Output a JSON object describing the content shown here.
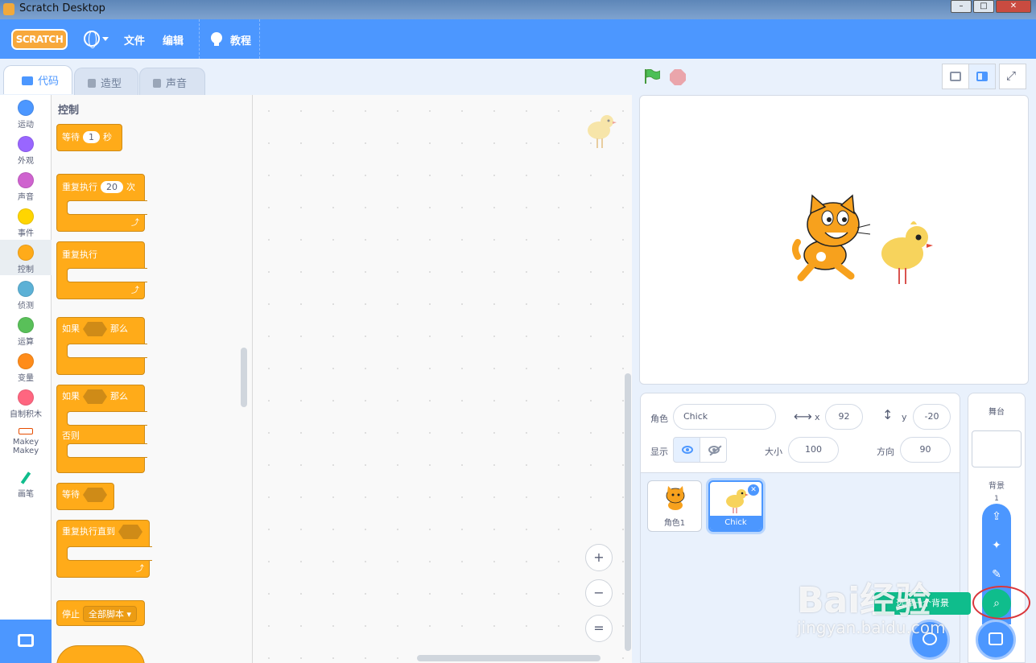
{
  "window": {
    "title": "Scratch Desktop"
  },
  "menubar": {
    "logo": "SCRATCH",
    "file": "文件",
    "edit": "编辑",
    "tutorials": "教程"
  },
  "tabs": [
    {
      "label": "代码",
      "active": true
    },
    {
      "label": "造型",
      "active": false
    },
    {
      "label": "声音",
      "active": false
    }
  ],
  "categories": [
    {
      "label": "运动",
      "color": "#4c97ff"
    },
    {
      "label": "外观",
      "color": "#9966ff"
    },
    {
      "label": "声音",
      "color": "#cf63cf"
    },
    {
      "label": "事件",
      "color": "#ffd500"
    },
    {
      "label": "控制",
      "color": "#ffab19",
      "selected": true
    },
    {
      "label": "侦测",
      "color": "#5cb1d6"
    },
    {
      "label": "运算",
      "color": "#59c059"
    },
    {
      "label": "变量",
      "color": "#ff8c1a"
    },
    {
      "label": "自制积木",
      "color": "#ff6680"
    },
    {
      "label": "Makey Makey",
      "color": "#e64d00"
    },
    {
      "label": "画笔",
      "color": "#0fbd8c"
    }
  ],
  "palette": {
    "title": "控制",
    "blocks": {
      "wait": "等待",
      "wait_value": "1",
      "wait_unit": "秒",
      "repeat": "重复执行",
      "repeat_value": "20",
      "repeat_unit": "次",
      "forever": "重复执行",
      "if_then_a": "如果",
      "if_then_b": "那么",
      "if_else_a": "如果",
      "if_else_b": "那么",
      "else": "否则",
      "wait_until": "等待",
      "repeat_until": "重复执行直到",
      "stop": "停止",
      "stop_option": "全部脚本"
    }
  },
  "zoom": {
    "in": "+",
    "out": "−",
    "reset": "="
  },
  "sprite_info": {
    "sprite_label": "角色",
    "sprite_name": "Chick",
    "x_label": "x",
    "x_value": "92",
    "y_label": "y",
    "y_value": "-20",
    "show_label": "显示",
    "size_label": "大小",
    "size_value": "100",
    "direction_label": "方向",
    "direction_value": "90"
  },
  "sprites": [
    {
      "name": "角色1",
      "selected": false
    },
    {
      "name": "Chick",
      "selected": true
    }
  ],
  "stage_pane": {
    "header": "舞台",
    "backdrops_label": "背景",
    "backdrops_count": "1"
  },
  "tooltip": "选择一个背景",
  "watermark": {
    "brand": "Bai经验",
    "url": "jingyan.baidu.com"
  },
  "colors": {
    "menubar": "#4c97ff",
    "control": "#ffab19",
    "background": "#e9f1fc"
  }
}
